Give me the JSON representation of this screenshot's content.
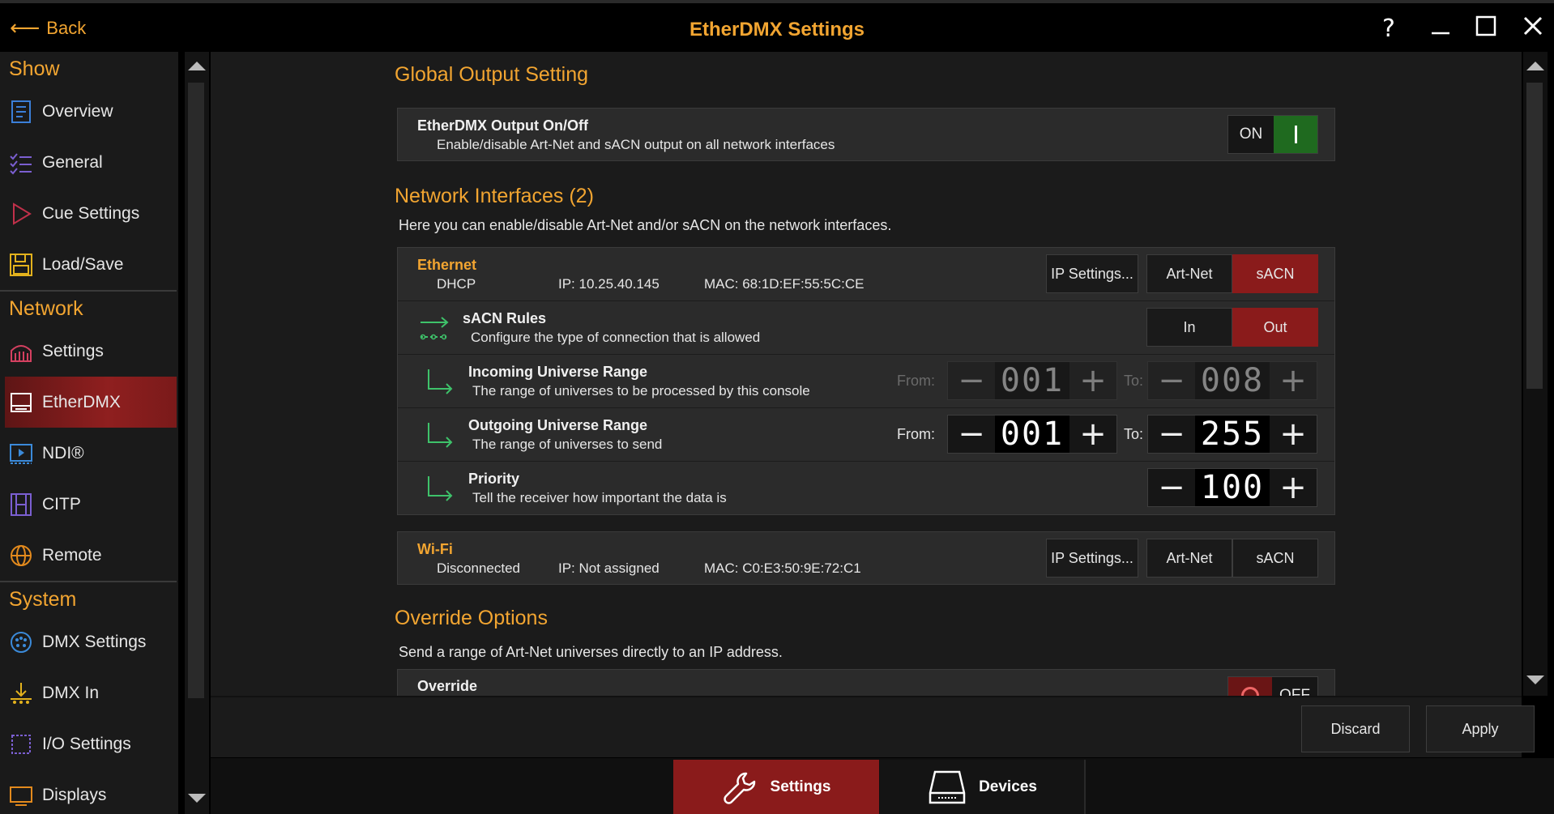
{
  "titlebar": {
    "back_label": "Back",
    "title": "EtherDMX Settings",
    "help": "?",
    "minimize": "—",
    "close": "✕"
  },
  "sidebar": {
    "show_header": "Show",
    "network_header": "Network",
    "system_header": "System",
    "items": {
      "overview": "Overview",
      "general": "General",
      "cue_settings": "Cue Settings",
      "load_save": "Load/Save",
      "settings": "Settings",
      "etherdmx": "EtherDMX",
      "ndi": "NDI®",
      "citp": "CITP",
      "remote": "Remote",
      "dmx_settings": "DMX Settings",
      "dmx_in": "DMX In",
      "io_settings": "I/O Settings",
      "displays": "Displays"
    },
    "active": "EtherDMX"
  },
  "global_output": {
    "heading": "Global Output Setting",
    "title": "EtherDMX Output On/Off",
    "subtitle": "Enable/disable Art-Net and sACN output on all network interfaces",
    "toggle_label": "ON",
    "toggle_state": true
  },
  "network_interfaces": {
    "heading": "Network Interfaces (2)",
    "description": "Here you can enable/disable Art-Net and/or sACN on the network interfaces.",
    "ethernet": {
      "name": "Ethernet",
      "mode": "DHCP",
      "ip": "IP: 10.25.40.145",
      "mac": "MAC: 68:1D:EF:55:5C:CE",
      "ip_settings_label": "IP Settings...",
      "artnet_label": "Art-Net",
      "sacn_label": "sACN",
      "sacn_enabled": true,
      "sacn_rules": {
        "title": "sACN Rules",
        "subtitle": "Configure the type of connection that is allowed",
        "in_label": "In",
        "out_label": "Out",
        "selected": "Out"
      },
      "incoming": {
        "title": "Incoming Universe Range",
        "subtitle": "The range of universes to be processed by this console",
        "from_label": "From:",
        "to_label": "To:",
        "from_value": "001",
        "to_value": "008"
      },
      "outgoing": {
        "title": "Outgoing Universe Range",
        "subtitle": "The range of universes to send",
        "from_label": "From:",
        "to_label": "To:",
        "from_value": "001",
        "to_value": "255"
      },
      "priority": {
        "title": "Priority",
        "subtitle": "Tell the receiver how important the data is",
        "value": "100"
      }
    },
    "wifi": {
      "name": "Wi-Fi",
      "status": "Disconnected",
      "ip": "IP: Not assigned",
      "mac": "MAC: C0:E3:50:9E:72:C1",
      "ip_settings_label": "IP Settings...",
      "artnet_label": "Art-Net",
      "sacn_label": "sACN"
    }
  },
  "override": {
    "heading": "Override Options",
    "description": "Send a range of Art-Net universes directly to an IP address.",
    "title": "Override",
    "toggle_label": "OFF"
  },
  "footer": {
    "discard_label": "Discard",
    "apply_label": "Apply"
  },
  "tabs": {
    "settings_label": "Settings",
    "devices_label": "Devices",
    "active": "Settings"
  },
  "colors": {
    "accent": "#f2a531",
    "active_red": "#8a1b1b",
    "toggle_green": "#1f6a1f",
    "arrow_green": "#3ec26a"
  }
}
